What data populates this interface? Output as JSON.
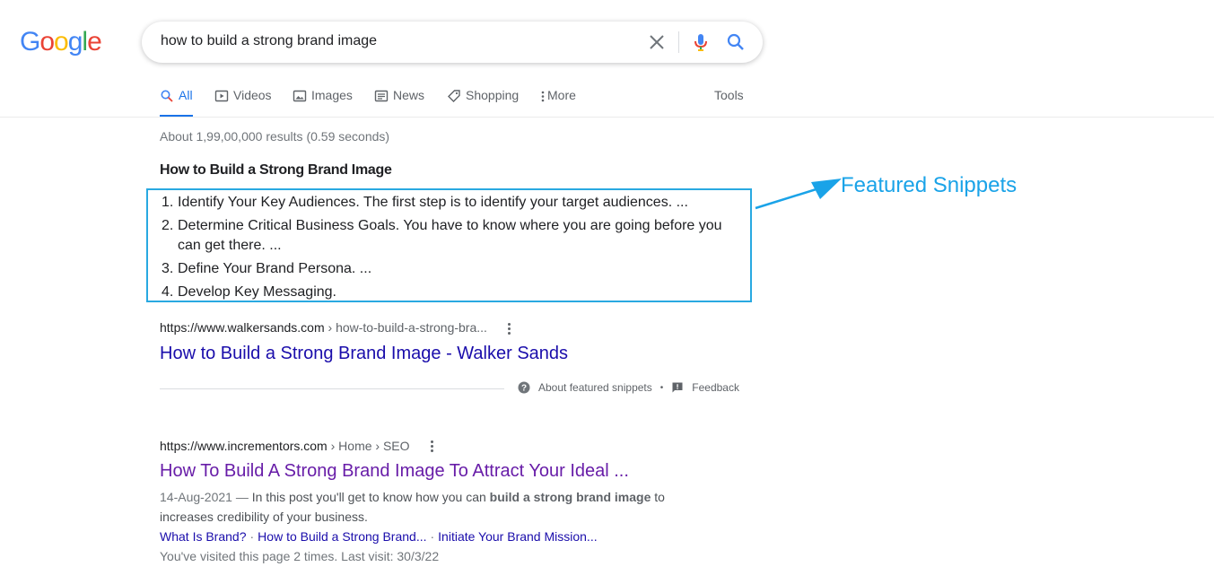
{
  "logo": {
    "letters": [
      "G",
      "o",
      "o",
      "g",
      "l",
      "e"
    ],
    "colors": [
      "#4285f4",
      "#ea4335",
      "#fbbc05",
      "#4285f4",
      "#34a853",
      "#ea4335"
    ]
  },
  "search": {
    "query": "how to build a strong brand image"
  },
  "tabs": [
    {
      "label": "All",
      "icon": "search-icon",
      "active": true
    },
    {
      "label": "Videos",
      "icon": "play-icon"
    },
    {
      "label": "Images",
      "icon": "image-icon"
    },
    {
      "label": "News",
      "icon": "news-icon"
    },
    {
      "label": "Shopping",
      "icon": "tag-icon"
    },
    {
      "label": "More",
      "icon": "kebab-icon"
    }
  ],
  "tools_label": "Tools",
  "result_stats": "About 1,99,00,000 results (0.59 seconds)",
  "featured_snippet": {
    "heading": "How to Build a Strong Brand Image",
    "items": [
      {
        "num": "1.",
        "text": "Identify Your Key Audiences. The first step is to identify your target audiences. ..."
      },
      {
        "num": "2.",
        "text": "Determine Critical Business Goals. You have to know where you are going before you can get there. ..."
      },
      {
        "num": "3.",
        "text": "Define Your Brand Persona. ..."
      },
      {
        "num": "4.",
        "text": "Develop Key Messaging."
      }
    ],
    "url_domain": "https://www.walkersands.com",
    "url_path": " › how-to-build-a-strong-bra...",
    "title": "How to Build a Strong Brand Image - Walker Sands",
    "about_label": "About featured snippets",
    "separator": "•",
    "feedback_label": "Feedback"
  },
  "annotation": {
    "label": "Featured Snippets",
    "color": "#1aa3e8"
  },
  "result2": {
    "url_domain": "https://www.incrementors.com",
    "url_path": " › Home › SEO",
    "title": "How To Build A Strong Brand Image To Attract Your Ideal ...",
    "date": "14-Aug-2021 — ",
    "snippet_before": "In this post you'll get to know how you can ",
    "snippet_bold": "build a strong brand image",
    "snippet_after": " to increases credibility of your business.",
    "sitelinks": [
      "What Is Brand?",
      "How to Build a Strong Brand...",
      "Initiate Your Brand Mission..."
    ],
    "sitelink_sep": "·",
    "visited_note": "You've visited this page 2 times. Last visit: 30/3/22"
  }
}
